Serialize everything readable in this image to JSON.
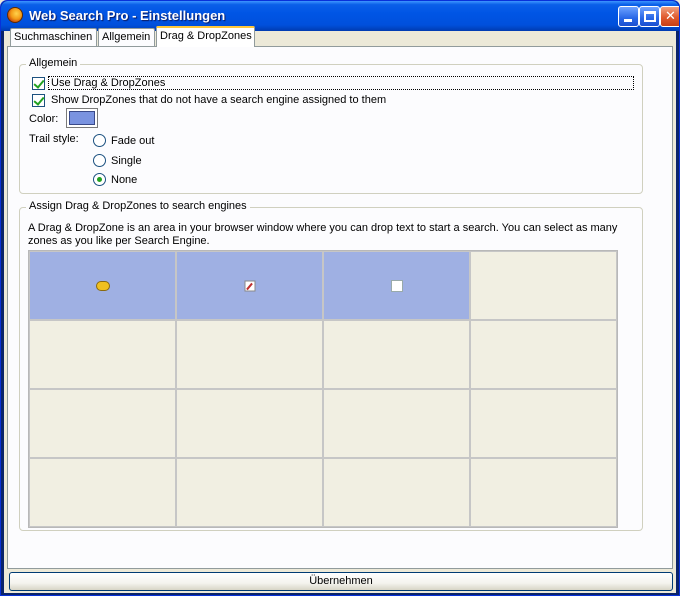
{
  "window": {
    "title": "Web Search Pro - Einstellungen",
    "icon": "firefox-icon"
  },
  "tabs": [
    {
      "label": "Suchmaschinen",
      "active": false
    },
    {
      "label": "Allgemein",
      "active": false
    },
    {
      "label": "Drag & DropZones",
      "active": true
    }
  ],
  "general_group": {
    "legend": "Allgemein",
    "use_dropzones": {
      "label": "Use Drag & DropZones",
      "checked": true
    },
    "show_unassigned": {
      "label": "Show DropZones that do not have a search engine assigned to them",
      "checked": true
    },
    "color_label": "Color:",
    "color_value": "#7a93e0",
    "trail_style_label": "Trail style:",
    "trail_options": [
      {
        "label": "Fade out",
        "checked": false
      },
      {
        "label": "Single",
        "checked": false
      },
      {
        "label": "None",
        "checked": true
      }
    ]
  },
  "assign_group": {
    "legend": "Assign Drag & DropZones to search engines",
    "description": "A Drag & DropZone is an area in your browser window where you can drop text to start a search. You can select as many zones as you like per Search Engine.",
    "assigned_color": "#9fb0e3",
    "grid_rows": 4,
    "grid_cols": 4,
    "assigned_cells": [
      {
        "row": 0,
        "col": 0,
        "icon": "bing-icon"
      },
      {
        "row": 0,
        "col": 1,
        "icon": "edit-icon"
      },
      {
        "row": 0,
        "col": 2,
        "icon": "google-icon"
      }
    ]
  },
  "footer": {
    "apply_label": "Übernehmen"
  }
}
